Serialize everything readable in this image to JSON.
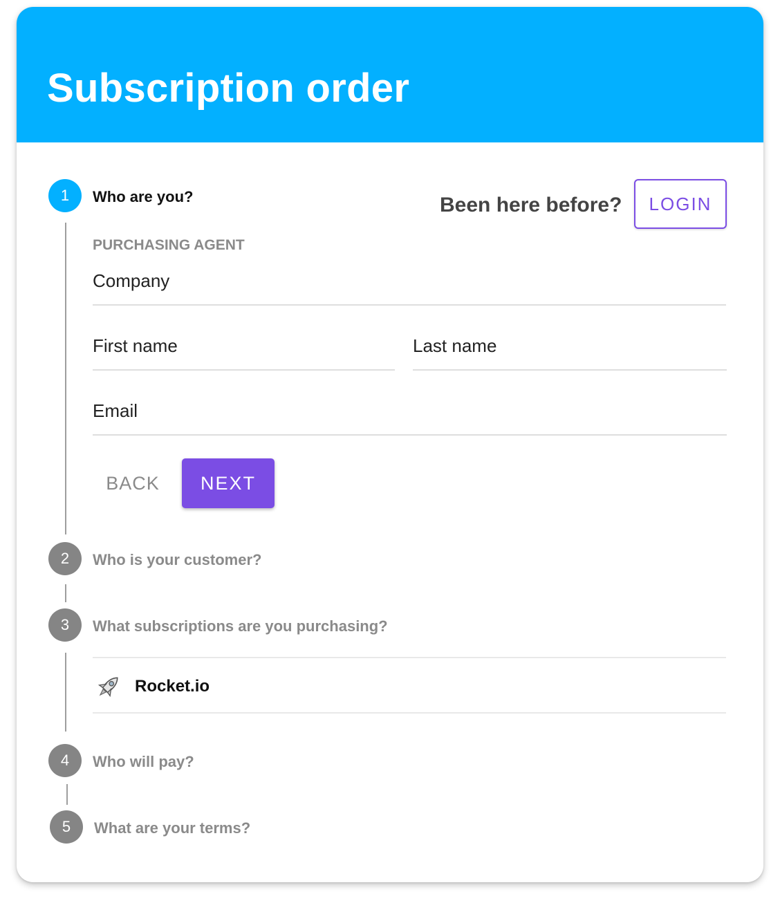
{
  "header": {
    "title": "Subscription order",
    "color": "#03b0ff"
  },
  "login_prompt": {
    "text": "Been here before?",
    "button_label": "LOGIN",
    "accent": "#7b4de4"
  },
  "steps": [
    {
      "number": "1",
      "title": "Who are you?",
      "active": true
    },
    {
      "number": "2",
      "title": "Who is your customer?",
      "active": false
    },
    {
      "number": "3",
      "title": "What subscriptions are you purchasing?",
      "active": false
    },
    {
      "number": "4",
      "title": "Who will pay?",
      "active": false
    },
    {
      "number": "5",
      "title": "What are your terms?",
      "active": false
    }
  ],
  "form": {
    "section_label": "PURCHASING AGENT",
    "company_placeholder": "Company",
    "first_name_placeholder": "First name",
    "last_name_placeholder": "Last name",
    "email_placeholder": "Email",
    "back_label": "BACK",
    "next_label": "NEXT"
  },
  "subscriptions": [
    {
      "name": "Rocket.io",
      "icon": "rocket-icon"
    }
  ]
}
